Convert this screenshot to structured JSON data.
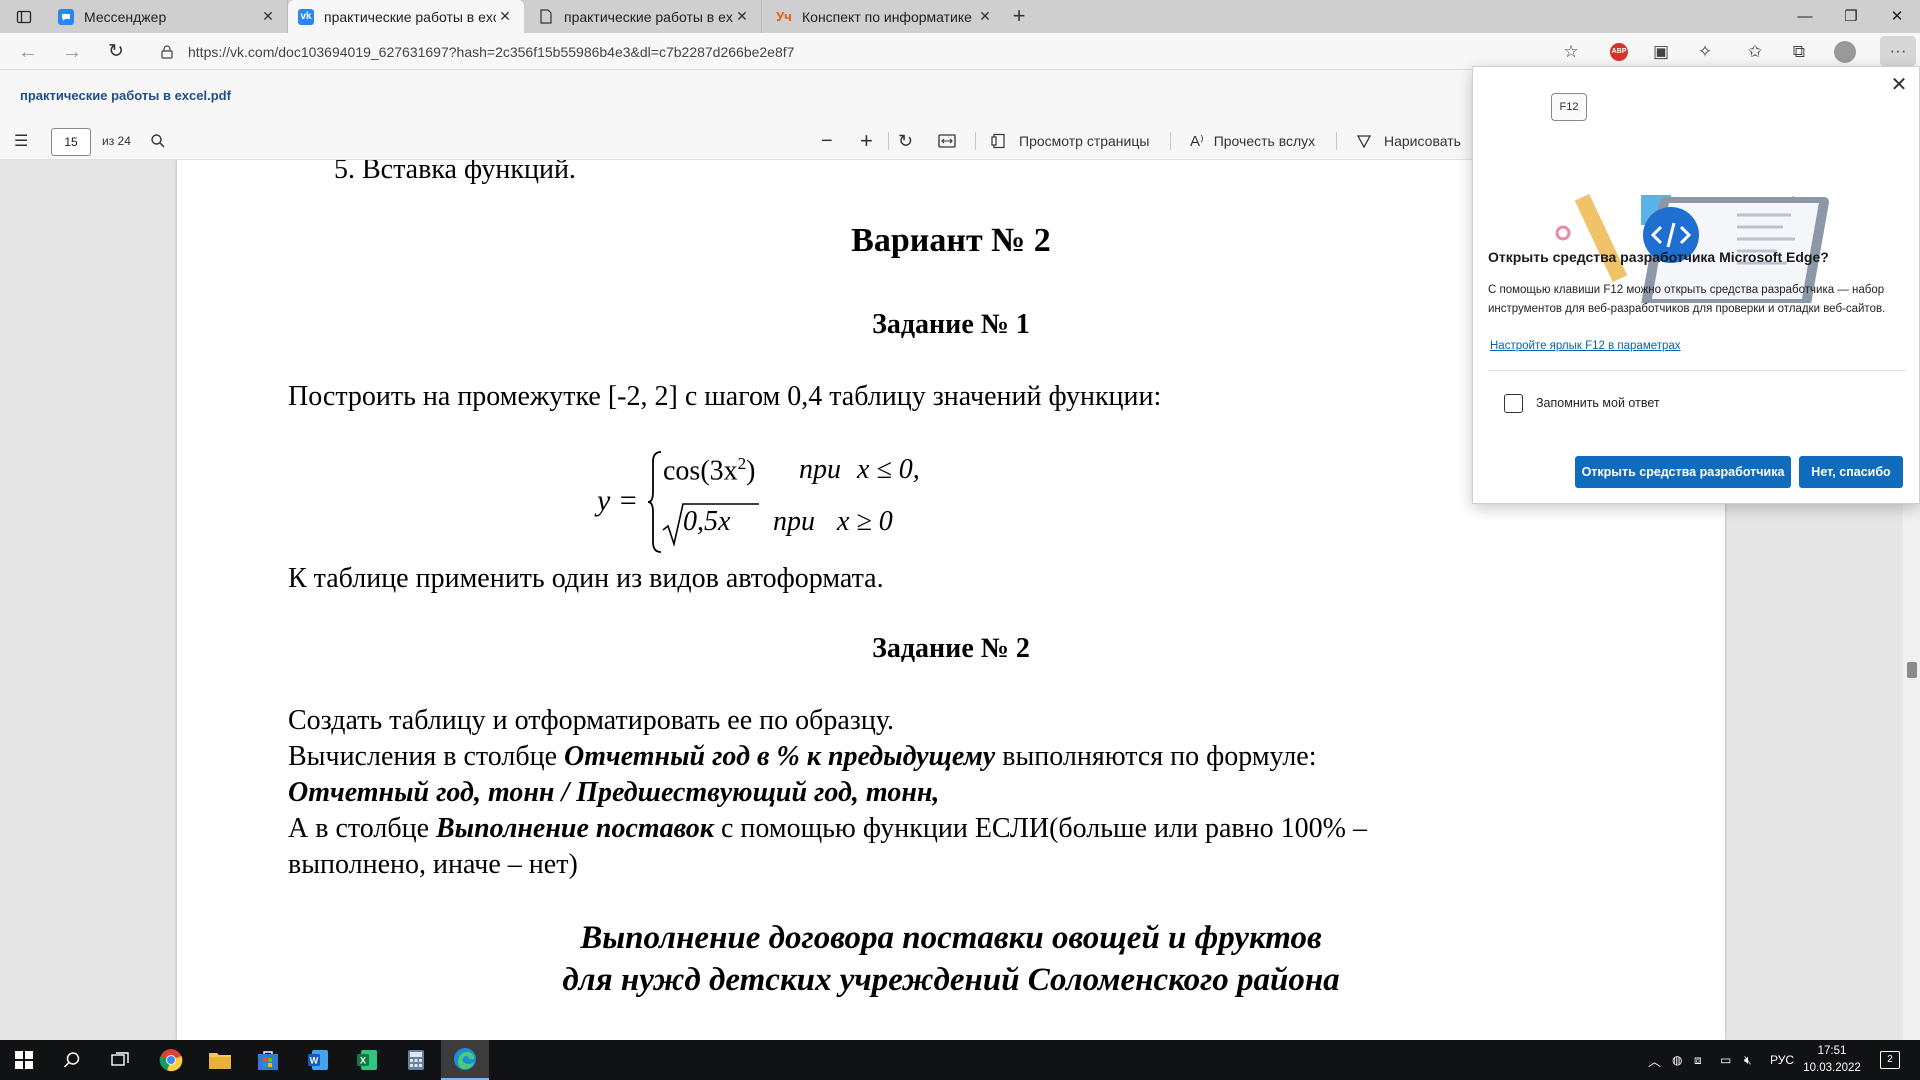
{
  "browser": {
    "tabs": [
      {
        "label": "Мессенджер",
        "fav_color": "#2787f5",
        "icon": "messenger-icon"
      },
      {
        "label": "практические работы в excel.p",
        "fav_color": "#2787f5",
        "icon": "vk-icon"
      },
      {
        "label": "практические работы в excel.d",
        "fav_color": "#ffffff",
        "icon": "document-icon"
      },
      {
        "label": "Конспект по информатике \"Пр",
        "fav_color": "#e35b13",
        "icon": "infourok-icon"
      }
    ],
    "url": "https://vk.com/doc103694019_627631697?hash=2c356f15b55986b4e3&dl=c7b2287d266be2e8f7",
    "abp_label": "ABP"
  },
  "pdf": {
    "title": "практические работы в excel.pdf",
    "page_current": "15",
    "page_total": "из 24",
    "toolbar": {
      "page_view": "Просмотр страницы",
      "read_aloud": "Прочесть вслух",
      "draw": "Нарисовать"
    }
  },
  "document": {
    "list_item": "5.   Вставка функций.",
    "variant": "Вариант № 2",
    "task1_heading": "Задание № 1",
    "task1_text": "Построить на промежутке [-2, 2] с шагом 0,4 таблицу значений функции:",
    "formula": {
      "y": "y =",
      "case1_expr": "cos(3x",
      "case1_exp": "2",
      "case1_close": ")",
      "case1_pri": "при",
      "case1_cond": "x ≤ 0,",
      "case2_expr": "0,5x",
      "case2_pri": "при",
      "case2_cond": "x ≥ 0"
    },
    "task1_autoformat": "К таблице применить один из видов автоформата.",
    "task2_heading": "Задание № 2",
    "task2_line1": "Создать таблицу и отформатировать ее по образцу.",
    "task2_line2_a": "Вычисления в столбце ",
    "task2_line2_b": "Отчетный год в % к предыдущему",
    "task2_line2_c": " выполняются по формуле:",
    "task2_line3": "Отчетный год, тонн / Предшествующий год, тонн,",
    "task2_line4_a": "А в столбце ",
    "task2_line4_b": "Выполнение поставок",
    "task2_line4_c": " с помощью функции ЕСЛИ(больше или равно 100%  –",
    "task2_line5": "выполнено, иначе – нет)",
    "table_title_1": "Выполнение договора поставки овощей и фруктов",
    "table_title_2": "для нужд детских учреждений Соломенского района"
  },
  "popup": {
    "key_label": "F12",
    "heading": "Открыть средства разработчика Microsoft Edge?",
    "description": "С помощью клавиши F12 можно открыть средства разработчика — набор инструментов для веб-разработчиков для проверки и отладки веб-сайтов.",
    "link": "Настройте ярлык F12 в параметрах",
    "checkbox_label": "Запомнить мой ответ",
    "primary_button": "Открыть средства разработчика",
    "secondary_button": "Нет, спасибо"
  },
  "taskbar": {
    "language": "РУС",
    "time": "17:51",
    "date": "10.03.2022",
    "notifications": "2"
  },
  "colors": {
    "accent": "#0f6cbd",
    "taskbar": "#111214",
    "tabstrip": "#cfcfcf"
  }
}
